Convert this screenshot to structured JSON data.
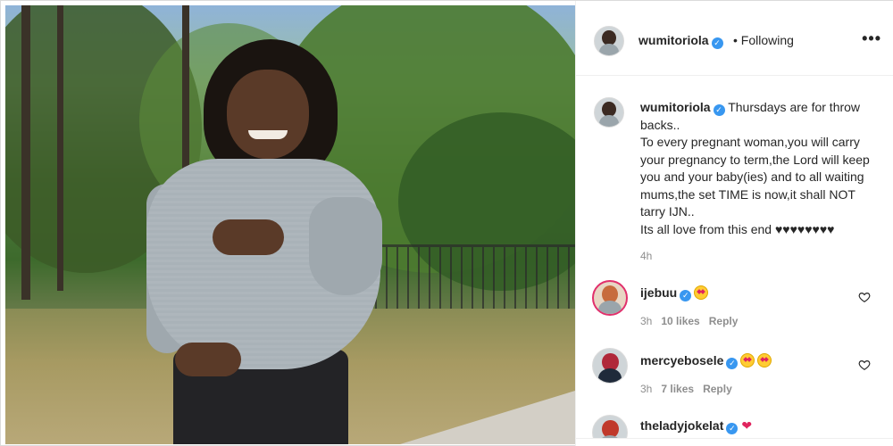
{
  "post": {
    "author": {
      "username": "wumitoriola",
      "verified": true,
      "follow_status": "• Following",
      "avatar_icon": "profile-avatar"
    },
    "more_options_icon": "more-horizontal-icon",
    "more_options_glyph": "•••",
    "caption": {
      "username": "wumitoriola",
      "text": "Thursdays are for throw backs..\nTo every pregnant woman,you will carry your pregnancy to term,the Lord will keep you and your baby(ies) and to all waiting mums,the set TIME is now,it shall NOT tarry IJN..\nIts all love from this end ♥♥♥♥♥♥♥♥",
      "time": "4h"
    },
    "comments": [
      {
        "username": "ijebuu",
        "verified": true,
        "text_emoji": "star-struck-emoji",
        "time": "3h",
        "likes": "10 likes",
        "reply": "Reply"
      },
      {
        "username": "mercyebosele",
        "verified": true,
        "text_emoji": "star-struck-emoji x2",
        "time": "3h",
        "likes": "7 likes",
        "reply": "Reply"
      },
      {
        "username": "theladyjokelat",
        "verified": true,
        "text_emoji": "red-heart-emoji"
      }
    ]
  },
  "colors": {
    "verified_blue": "#3897f0",
    "text_primary": "#262626",
    "text_secondary": "#8e8e8e",
    "border": "#efefef"
  }
}
